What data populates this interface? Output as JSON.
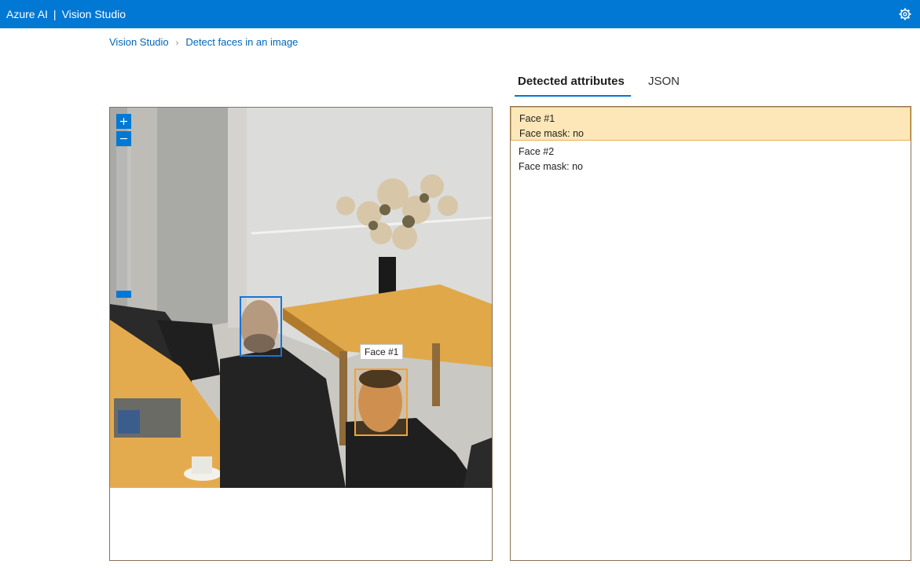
{
  "header": {
    "brand_left": "Azure AI",
    "brand_sep": "|",
    "brand_right": "Vision Studio",
    "settings_icon": "gear-icon",
    "accent": "#0078d4"
  },
  "breadcrumb": {
    "items": [
      "Vision Studio",
      "Detect faces in an image"
    ],
    "separator": "›"
  },
  "tabs": [
    {
      "label": "Detected attributes",
      "selected": true
    },
    {
      "label": "JSON",
      "selected": false
    }
  ],
  "image_viewer": {
    "zoom_in_icon": "plus-icon",
    "zoom_out_icon": "minus-icon",
    "tooltip": "Face #1",
    "box_colors": {
      "selected": "#f0a23a",
      "other": "#1a73d9"
    }
  },
  "faces": [
    {
      "title": "Face #1",
      "mask": "Face mask: no",
      "selected": true
    },
    {
      "title": "Face #2",
      "mask": "Face mask: no",
      "selected": false
    }
  ]
}
